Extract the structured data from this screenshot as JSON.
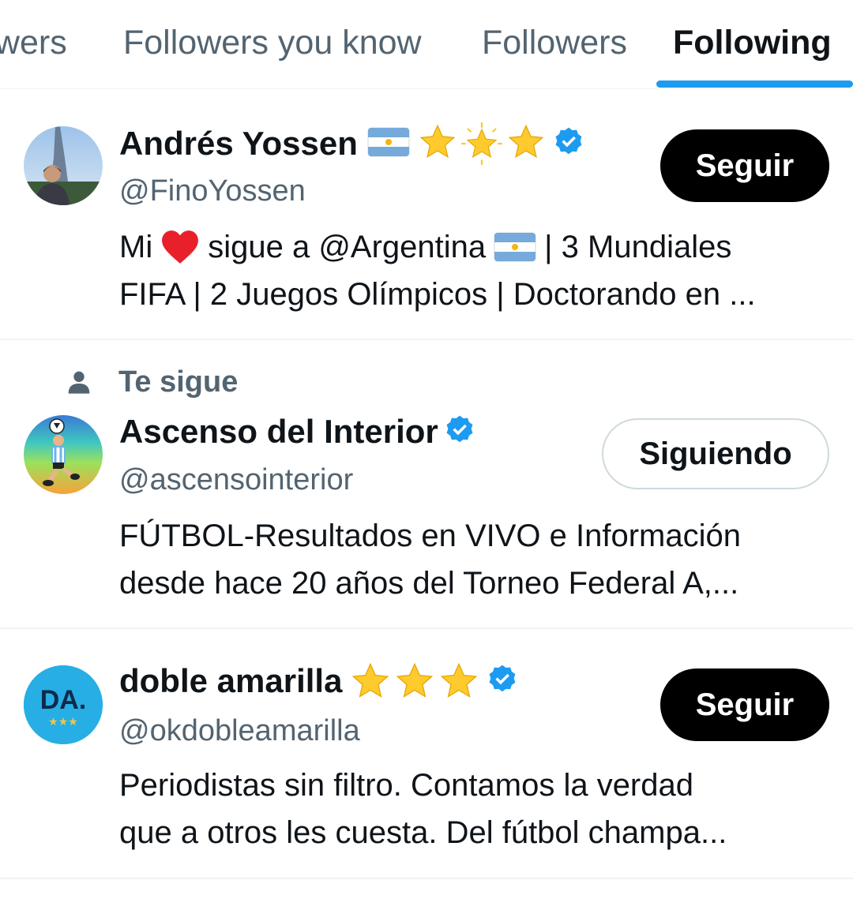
{
  "tabs": [
    {
      "label": "owers",
      "active": false
    },
    {
      "label": "Followers you know",
      "active": false
    },
    {
      "label": "Followers",
      "active": false
    },
    {
      "label": "Following",
      "active": true
    }
  ],
  "colors": {
    "accent": "#1d9bf0",
    "text": "#0f1419",
    "secondary_text": "#536471",
    "divider": "#eff3f4",
    "follow_button_bg": "#000000",
    "verified": "#1d9bf0"
  },
  "users": [
    {
      "name": "Andrés Yossen",
      "name_emojis": [
        "flag-argentina",
        "star",
        "glowing-star",
        "star"
      ],
      "verified": true,
      "handle": "@FinoYossen",
      "bio_line1_a": "Mi",
      "bio_line1_b": "sigue a @Argentina",
      "bio_line1_c": "| 3 Mundiales",
      "bio_line2": "FIFA | 2 Juegos Olímpicos | Doctorando en ...",
      "button": "Seguir",
      "follows_you": false
    },
    {
      "name": "Ascenso del Interior",
      "verified": true,
      "handle": "@ascensointerior",
      "bio_line1": "FÚTBOL-Resultados en VIVO e Información",
      "bio_line2": "desde hace 20 años del Torneo Federal A,...",
      "button": "Siguiendo",
      "follows_you": true,
      "follows_you_label": "Te sigue"
    },
    {
      "name": "doble amarilla",
      "name_emojis": [
        "star",
        "star",
        "star"
      ],
      "verified": true,
      "handle": "@okdobleamarilla",
      "avatar_text": "DA.",
      "avatar_stars": "★★★",
      "bio_line1": "Periodistas sin filtro. Contamos la verdad",
      "bio_line2": "que a otros les cuesta. Del fútbol champa...",
      "button": "Seguir",
      "follows_you": false
    }
  ]
}
